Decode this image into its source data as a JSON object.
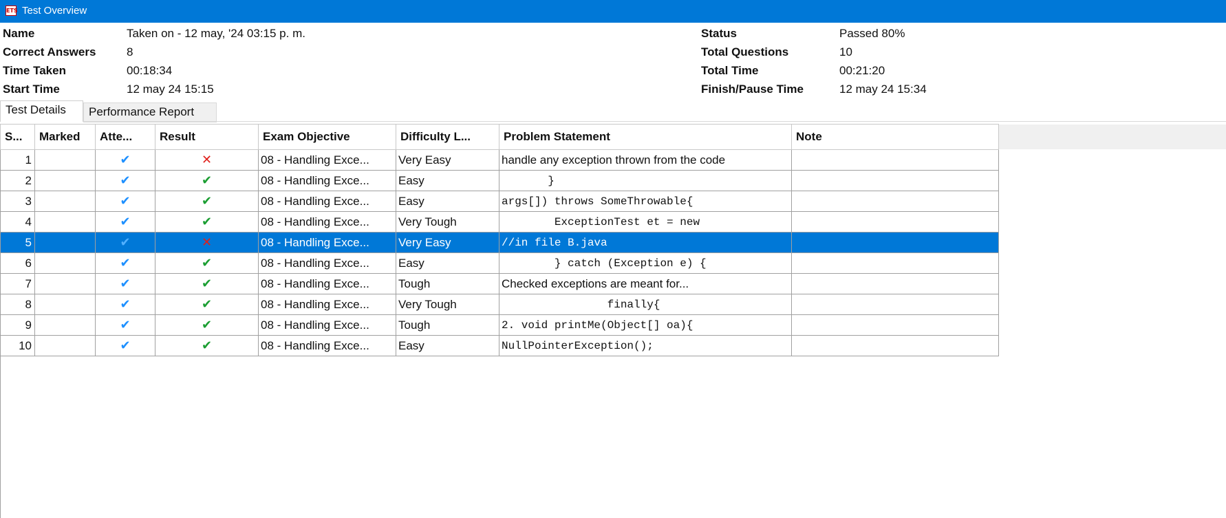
{
  "window": {
    "title": "Test Overview",
    "app_icon_text": "ETS"
  },
  "summary": {
    "name_label": "Name",
    "name_value": "Taken on - 12 may, '24 03:15 p. m.",
    "correct_label": "Correct Answers",
    "correct_value": "8",
    "time_taken_label": "Time Taken",
    "time_taken_value": "00:18:34",
    "start_label": "Start Time",
    "start_value": "12 may 24 15:15",
    "status_label": "Status",
    "status_value": "Passed 80%",
    "total_q_label": "Total Questions",
    "total_q_value": "10",
    "total_time_label": "Total Time",
    "total_time_value": "00:21:20",
    "finish_label": "Finish/Pause Time",
    "finish_value": "12 may 24 15:34"
  },
  "tabs": {
    "details": "Test Details",
    "report": "Performance Report"
  },
  "table": {
    "headers": [
      "S...",
      "Marked",
      "Atte...",
      "Result",
      "Exam Objective",
      "Difficulty L...",
      "Problem Statement",
      "Note"
    ],
    "rows": [
      {
        "n": "1",
        "objective": "08 - Handling Exce...",
        "difficulty": "Very Easy",
        "problem": "handle any exception thrown from the code",
        "result": "wrong",
        "mono": false
      },
      {
        "n": "2",
        "objective": "08 - Handling Exce...",
        "difficulty": "Easy",
        "problem": "       }",
        "result": "right",
        "mono": true
      },
      {
        "n": "3",
        "objective": "08 - Handling Exce...",
        "difficulty": "Easy",
        "problem": "args[]) throws SomeThrowable{",
        "result": "right",
        "mono": true
      },
      {
        "n": "4",
        "objective": "08 - Handling Exce...",
        "difficulty": "Very Tough",
        "problem": "        ExceptionTest et = new",
        "result": "right",
        "mono": true
      },
      {
        "n": "5",
        "objective": "08 - Handling Exce...",
        "difficulty": "Very Easy",
        "problem": "//in file B.java",
        "result": "wrong",
        "mono": true
      },
      {
        "n": "6",
        "objective": "08 - Handling Exce...",
        "difficulty": "Easy",
        "problem": "        } catch (Exception e) {",
        "result": "right",
        "mono": true
      },
      {
        "n": "7",
        "objective": "08 - Handling Exce...",
        "difficulty": "Tough",
        "problem": "Checked exceptions are meant for...",
        "result": "right",
        "mono": false
      },
      {
        "n": "8",
        "objective": "08 - Handling Exce...",
        "difficulty": "Very Tough",
        "problem": "                finally{",
        "result": "right",
        "mono": true
      },
      {
        "n": "9",
        "objective": "08 - Handling Exce...",
        "difficulty": "Tough",
        "problem": "2. void printMe(Object[] oa){",
        "result": "right",
        "mono": true
      },
      {
        "n": "10",
        "objective": "08 - Handling Exce...",
        "difficulty": "Easy",
        "problem": "NullPointerException();",
        "result": "right",
        "mono": true
      }
    ],
    "selected_row": "5"
  },
  "icons": {
    "attempted": "check-icon",
    "correct": "check-icon",
    "wrong": "cross-icon"
  },
  "colors": {
    "accent": "#0078d7",
    "correct": "#1b9e32",
    "wrong": "#e0201b",
    "attempted": "#1e90ff"
  }
}
